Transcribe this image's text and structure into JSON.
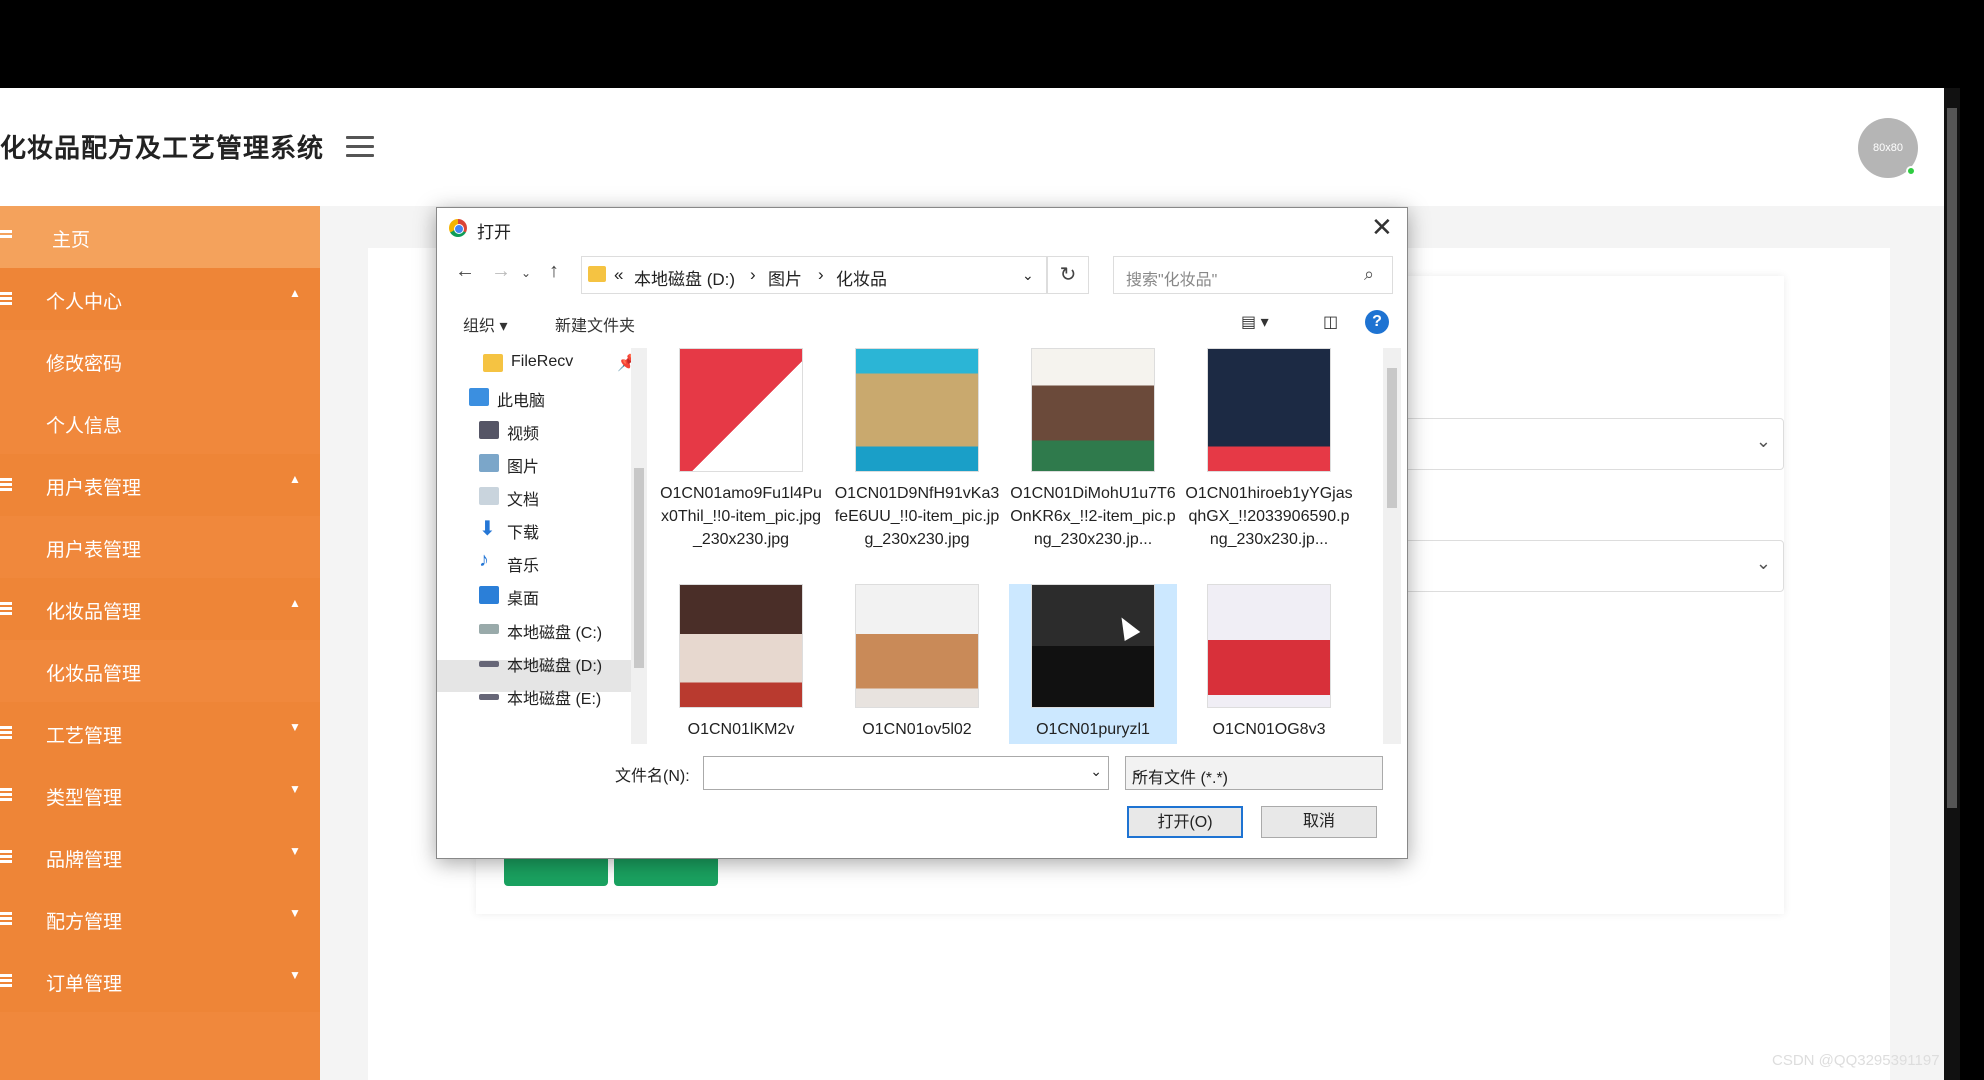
{
  "app": {
    "title": "化妆品配方及工艺管理系统",
    "avatar_text": "80x80"
  },
  "sidebar": {
    "items": [
      {
        "label": "主页"
      },
      {
        "label": "个人中心"
      },
      {
        "label": "修改密码"
      },
      {
        "label": "个人信息"
      },
      {
        "label": "用户表管理"
      },
      {
        "label": "用户表管理"
      },
      {
        "label": "化妆品管理"
      },
      {
        "label": "化妆品管理"
      },
      {
        "label": "工艺管理"
      },
      {
        "label": "类型管理"
      },
      {
        "label": "品牌管理"
      },
      {
        "label": "配方管理"
      },
      {
        "label": "订单管理"
      }
    ]
  },
  "dialog": {
    "title": "打开",
    "breadcrumb": [
      "«",
      "本地磁盘 (D:)",
      "›",
      "图片",
      "›",
      "化妆品"
    ],
    "search_placeholder": "搜索\"化妆品\"",
    "toolbar": {
      "organize": "组织 ▾",
      "new_folder": "新建文件夹",
      "help": "?"
    },
    "tree": [
      {
        "label": "FileRecv"
      },
      {
        "label": "此电脑"
      },
      {
        "label": "视频"
      },
      {
        "label": "图片"
      },
      {
        "label": "文档"
      },
      {
        "label": "下载"
      },
      {
        "label": "音乐"
      },
      {
        "label": "桌面"
      },
      {
        "label": "本地磁盘 (C:)"
      },
      {
        "label": "本地磁盘 (D:)"
      },
      {
        "label": "本地磁盘 (E:)"
      }
    ],
    "files": [
      {
        "name": "O1CN01amo9Fu1l4Pux0Thil_!!0-item_pic.jpg_230x230.jpg"
      },
      {
        "name": "O1CN01D9NfH91vKa3feE6UU_!!0-item_pic.jpg_230x230.jpg"
      },
      {
        "name": "O1CN01DiMohU1u7T6OnKR6x_!!2-item_pic.png_230x230.jp..."
      },
      {
        "name": "O1CN01hiroeb1yYGjasqhGX_!!2033906590.png_230x230.jp..."
      },
      {
        "name": "O1CN01lKM2v"
      },
      {
        "name": "O1CN01ov5l02"
      },
      {
        "name": "O1CN01puryzl1"
      },
      {
        "name": "O1CN01OG8v3"
      }
    ],
    "filename_label": "文件名(N):",
    "filename_value": "",
    "filter_value": "所有文件 (*.*)",
    "open_button": "打开(O)",
    "cancel_button": "取消"
  },
  "watermark": "CSDN @QQ3295391197",
  "colors": {
    "sidebar": "#f0883c",
    "accent_button": "#1aa260",
    "dialog_primary": "#1e73d2"
  }
}
